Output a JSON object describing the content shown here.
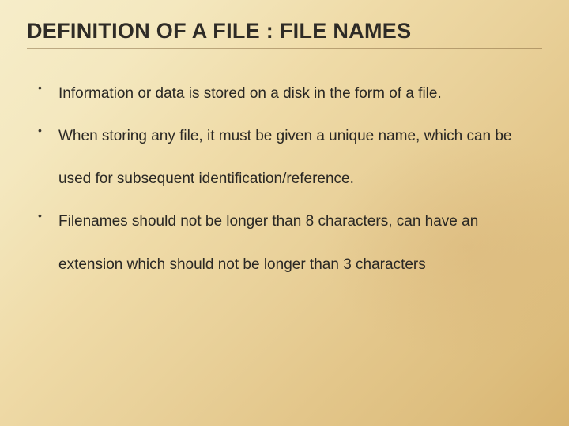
{
  "title": "DEFINITION OF A FILE : FILE NAMES",
  "bullets": [
    "Information or data is stored on a disk in the form of a file.",
    "When storing any file, it must be given a unique name, which can be used for subsequent identification/reference.",
    "Filenames should not be longer than 8 characters, can have an extension which should not be longer than 3 characters"
  ]
}
